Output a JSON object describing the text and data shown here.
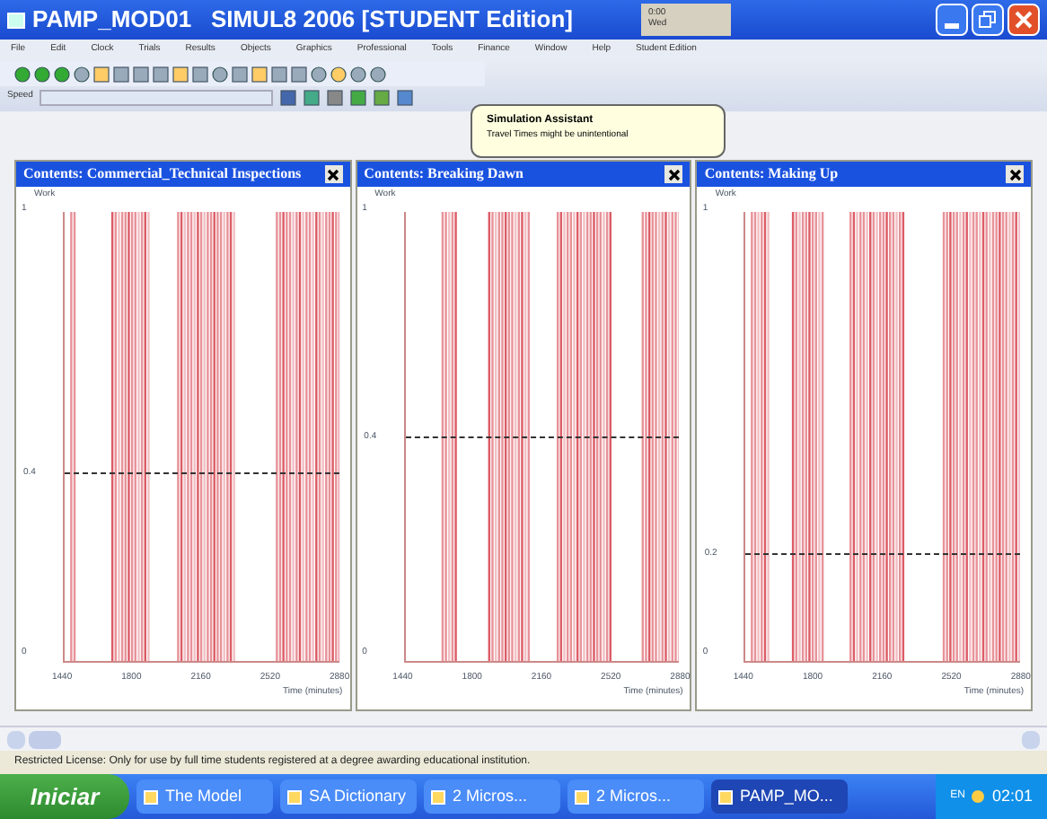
{
  "window": {
    "title": "PAMP_MOD01   SIMUL8 2006 [STUDENT Edition]",
    "clock": [
      "0:00",
      "Wed"
    ]
  },
  "menu": [
    "File",
    "Edit",
    "Clock",
    "Trials",
    "Results",
    "Objects",
    "Graphics",
    "Professional",
    "Tools",
    "Finance",
    "Window",
    "Help",
    "Student Edition"
  ],
  "speed": {
    "label": "Speed"
  },
  "tooltip": {
    "title": "Simulation Assistant",
    "text": "Travel Times might be unintentional"
  },
  "panels": [
    {
      "title": "Contents: Commercial_Technical Inspections",
      "ylabel": "Work",
      "ytop": "1",
      "ybottom": "0",
      "mean_label": "0.4",
      "xticks": [
        "1440",
        "1800",
        "2160",
        "2520",
        "2880"
      ],
      "xlabel": "Time (minutes)"
    },
    {
      "title": "Contents: Breaking Dawn",
      "ylabel": "Work",
      "ytop": "1",
      "ybottom": "0",
      "mean_label": "0.4",
      "xticks": [
        "1440",
        "1800",
        "2160",
        "2520",
        "2880"
      ],
      "xlabel": "Time (minutes)"
    },
    {
      "title": "Contents: Making Up",
      "ylabel": "Work",
      "ytop": "1",
      "ybottom": "0",
      "mean_label": "0.2",
      "xticks": [
        "1440",
        "1800",
        "2160",
        "2520",
        "2880"
      ],
      "xlabel": "Time (minutes)"
    }
  ],
  "status_bar": "Restricted License: Only for use by full time students registered at a degree awarding educational institution.",
  "taskbar": {
    "start": "Iniciar",
    "buttons": [
      {
        "label": "The Model",
        "selected": false
      },
      {
        "label": "SA Dictionary",
        "selected": false
      },
      {
        "label": "2 Micros...",
        "selected": false
      },
      {
        "label": "2 Micros...",
        "selected": false
      },
      {
        "label": "PAMP_MO...",
        "selected": true
      }
    ],
    "lang": "EN",
    "time": "02:01"
  }
}
